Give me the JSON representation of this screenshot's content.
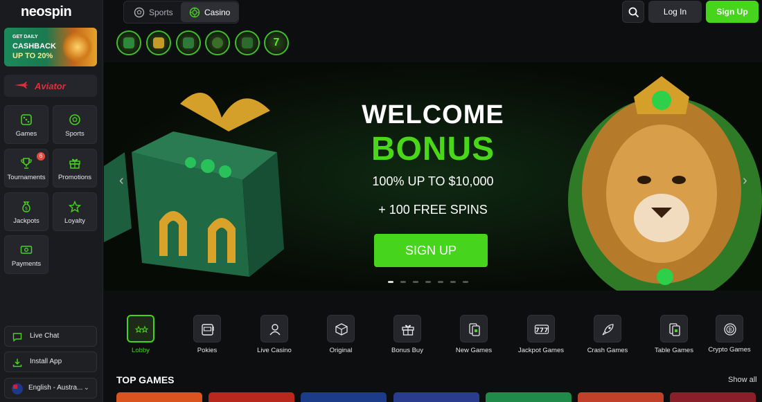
{
  "brand": {
    "logo_text": "neospin",
    "accent_color": "#46d41c"
  },
  "promo_banner": {
    "line1": "GET DAILY",
    "line2": "CASHBACK",
    "line3": "UP TO 20%"
  },
  "aviator": {
    "label": "Aviator"
  },
  "sidebar_tiles": [
    {
      "label": "Games",
      "icon": "dice-icon"
    },
    {
      "label": "Sports",
      "icon": "soccer-ball-icon"
    },
    {
      "label": "Tournaments",
      "icon": "trophy-icon",
      "badge": "6"
    },
    {
      "label": "Promotions",
      "icon": "gift-icon"
    },
    {
      "label": "Jackpots",
      "icon": "money-bag-icon"
    },
    {
      "label": "Loyalty",
      "icon": "star-icon"
    },
    {
      "label": "Payments",
      "icon": "banknote-icon"
    }
  ],
  "sidebar_bottom": {
    "live_chat": "Live Chat",
    "install_app": "Install App",
    "language": "English - Austra..."
  },
  "header": {
    "tabs": [
      {
        "label": "Sports"
      },
      {
        "label": "Casino"
      }
    ],
    "login": "Log In",
    "signup": "Sign Up"
  },
  "hero": {
    "headline_1": "WELCOME",
    "headline_2": "BONUS",
    "line_1": "100% UP TO $10,000",
    "line_2": "+ 100 FREE SPINS",
    "cta": "SIGN UP",
    "slide_count": 7,
    "active_slide": 1
  },
  "categories": [
    {
      "label": "Lobby",
      "icon": "stars-icon",
      "active": true
    },
    {
      "label": "Pokies",
      "icon": "slot-machine-icon"
    },
    {
      "label": "Live Casino",
      "icon": "dealer-icon"
    },
    {
      "label": "Original",
      "icon": "dice-cube-icon"
    },
    {
      "label": "Bonus Buy",
      "icon": "gift-box-icon"
    },
    {
      "label": "New Games",
      "icon": "new-cards-icon"
    },
    {
      "label": "Jackpot Games",
      "icon": "triple-seven-icon"
    },
    {
      "label": "Crash Games",
      "icon": "rocket-icon"
    },
    {
      "label": "Table Games",
      "icon": "cards-icon"
    },
    {
      "label": "Crypto Games",
      "icon": "crypto-coin-icon"
    }
  ],
  "top_games": {
    "title": "TOP GAMES",
    "show_all": "Show all"
  }
}
